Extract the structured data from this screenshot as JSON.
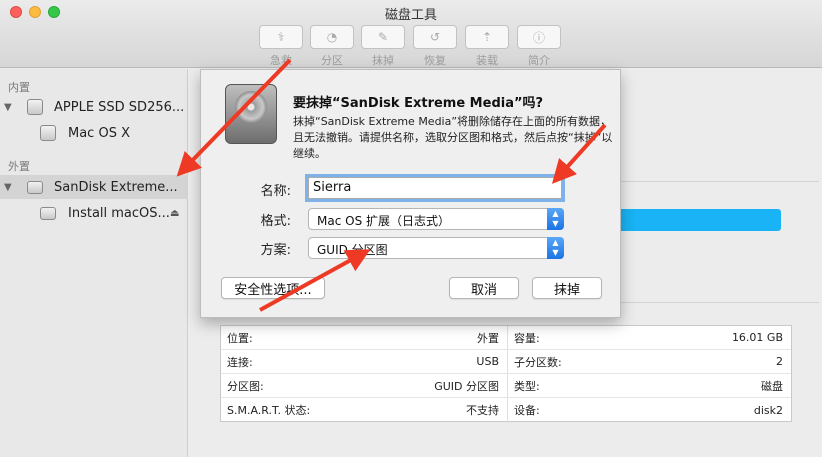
{
  "window": {
    "title": "磁盘工具"
  },
  "toolbar": {
    "items": [
      {
        "label": "急救",
        "icon": "stethoscope-icon",
        "glyph": "⚕"
      },
      {
        "label": "分区",
        "icon": "partition-icon",
        "glyph": "◔"
      },
      {
        "label": "抹掉",
        "icon": "erase-icon",
        "glyph": "✎"
      },
      {
        "label": "恢复",
        "icon": "restore-icon",
        "glyph": "↺"
      },
      {
        "label": "装载",
        "icon": "mount-icon",
        "glyph": "⇡"
      },
      {
        "label": "简介",
        "icon": "info-icon",
        "glyph": "ⓘ"
      }
    ]
  },
  "sidebar": {
    "internal_label": "内置",
    "external_label": "外置",
    "items": [
      {
        "label": "APPLE SSD SD256...",
        "icon": "internal-disk-icon"
      },
      {
        "label": "Mac OS X",
        "icon": "volume-icon"
      },
      {
        "label": "SanDisk Extreme...",
        "icon": "external-disk-icon"
      },
      {
        "label": "Install macOS...",
        "icon": "volume-icon"
      }
    ]
  },
  "dialog": {
    "title": "要抹掉“SanDisk Extreme Media”吗?",
    "description": "抹掉“SanDisk Extreme Media”将删除储存在上面的所有数据，且无法撤销。请提供名称，选取分区图和格式，然后点按“抹掉”以继续。",
    "name_label": "名称:",
    "name_value": "Sierra",
    "format_label": "格式:",
    "format_value": "Mac OS 扩展（日志式）",
    "scheme_label": "方案:",
    "scheme_value": "GUID 分区图",
    "security_button": "安全性选项...",
    "cancel_button": "取消",
    "erase_button": "抹掉"
  },
  "info": {
    "left": [
      {
        "key": "位置:",
        "value": "外置"
      },
      {
        "key": "连接:",
        "value": "USB"
      },
      {
        "key": "分区图:",
        "value": "GUID 分区图"
      },
      {
        "key": "S.M.A.R.T. 状态:",
        "value": "不支持"
      }
    ],
    "right": [
      {
        "key": "容量:",
        "value": "16.01 GB"
      },
      {
        "key": "子分区数:",
        "value": "2"
      },
      {
        "key": "类型:",
        "value": "磁盘"
      },
      {
        "key": "设备:",
        "value": "disk2"
      }
    ]
  },
  "colors": {
    "accent": "#1ab3f5",
    "arrow": "#ee3a24",
    "focus_ring": "#7fb1ea"
  }
}
